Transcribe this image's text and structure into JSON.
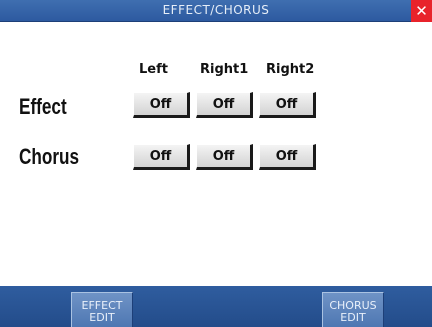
{
  "title": "EFFECT/CHORUS",
  "close_glyph": "✕",
  "columns": [
    "Left",
    "Right1",
    "Right2"
  ],
  "rows": [
    {
      "label": "Effect",
      "values": [
        "Off",
        "Off",
        "Off"
      ]
    },
    {
      "label": "Chorus",
      "values": [
        "Off",
        "Off",
        "Off"
      ]
    }
  ],
  "softkeys": {
    "left": {
      "line1": "EFFECT",
      "line2": "EDIT"
    },
    "right": {
      "line1": "CHORUS",
      "line2": "EDIT"
    }
  }
}
